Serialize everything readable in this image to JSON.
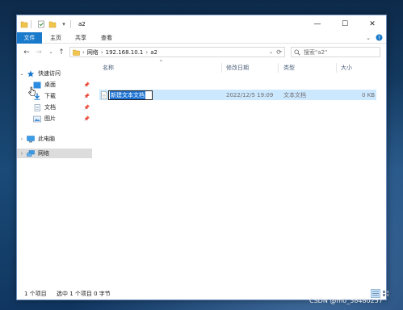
{
  "window": {
    "title": "a2",
    "controls": {
      "minimize": "—",
      "maximize": "☐",
      "close": "✕"
    }
  },
  "ribbon": {
    "tabs": [
      "文件",
      "主页",
      "共享",
      "查看"
    ],
    "expand_icon": "chevron-down-icon",
    "help_icon": "help-icon"
  },
  "address": {
    "breadcrumbs": [
      "网络",
      "192.168.10.1",
      "a2"
    ],
    "search_placeholder": "搜索\"a2\""
  },
  "sidebar": {
    "items": [
      {
        "label": "快速访问",
        "icon": "star-icon",
        "expanded": true
      },
      {
        "label": "桌面",
        "icon": "desktop-icon",
        "pinned": true
      },
      {
        "label": "下载",
        "icon": "download-icon",
        "pinned": true
      },
      {
        "label": "文档",
        "icon": "documents-icon",
        "pinned": true
      },
      {
        "label": "图片",
        "icon": "pictures-icon",
        "pinned": true
      },
      {
        "label": "此电脑",
        "icon": "computer-icon"
      },
      {
        "label": "网络",
        "icon": "network-icon",
        "selected": true
      }
    ]
  },
  "list": {
    "columns": [
      "名称",
      "修改日期",
      "类型",
      "大小"
    ],
    "files": [
      {
        "name": "新建文本文档",
        "modified": "2022/12/5 19:09",
        "type": "文本文档",
        "size": "0 KB",
        "renaming": true
      }
    ]
  },
  "status": {
    "item_count": "1 个项目",
    "selected": "选中 1 个项目 0 字节"
  },
  "watermark": "CSDN @m0_58480257",
  "colors": {
    "accent": "#1979ca",
    "selection": "#cce8ff",
    "text_selection": "#1d72d3"
  }
}
